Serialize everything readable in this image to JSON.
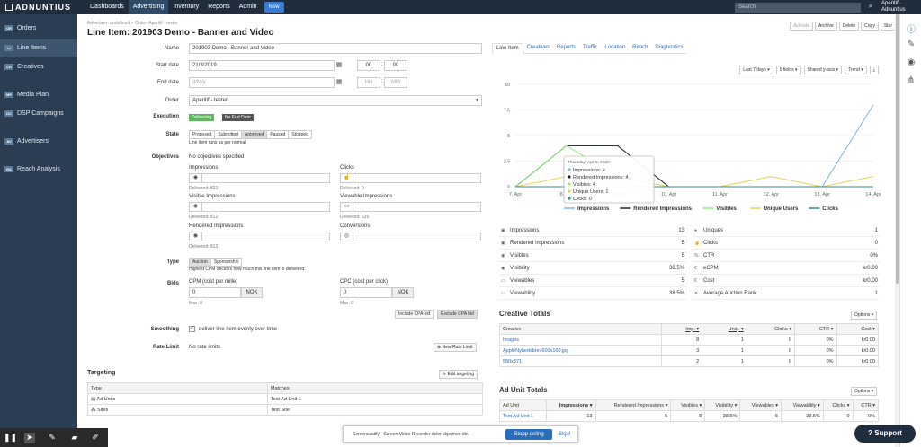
{
  "app": {
    "logo": "ADNUNTIUS",
    "nav": [
      "Dashboards",
      "Advertising",
      "Inventory",
      "Reports",
      "Admin"
    ],
    "new_label": "New",
    "search_placeholder": "Search",
    "user_line1": "Aperitif ·",
    "user_line2": "Adnuntius"
  },
  "sidebar": {
    "items": [
      {
        "icon": "OR",
        "label": "Orders"
      },
      {
        "icon": "LI",
        "label": "Line Items"
      },
      {
        "icon": "CR",
        "label": "Creatives"
      },
      {
        "icon": "MP",
        "label": "Media Plan"
      },
      {
        "icon": "DC",
        "label": "DSP Campaigns"
      },
      {
        "icon": "AV",
        "label": "Advertisers"
      },
      {
        "icon": "RA",
        "label": "Reach Analysis"
      }
    ]
  },
  "page": {
    "breadcrumb": "Advertiser: undefined  >  Order: Aperitif - tester",
    "title": "Line Item: 201903 Demo - Banner and Video",
    "top_buttons": [
      "Activate",
      "Archive",
      "Delete",
      "Copy",
      "Star"
    ]
  },
  "form": {
    "name_label": "Name",
    "name_value": "201903 Demo - Banner and Video",
    "start_label": "Start date",
    "start_value": "21/3/2019",
    "start_h": "00",
    "start_m": "00",
    "end_label": "End date",
    "end_placeholder": "d/M/y",
    "end_h": "HH",
    "end_m": "MM",
    "order_label": "Order",
    "order_value": "Aperitif - tester",
    "execution_label": "Execution",
    "exec_badge1": "Delivering",
    "exec_badge2": "No End Date",
    "state_label": "State",
    "states": [
      "Proposed",
      "Submitted",
      "Approved",
      "Paused",
      "Stopped"
    ],
    "state_note": "Line item runs as per normal",
    "objectives_label": "Objectives",
    "objectives_note": "No objectives specified",
    "obj": [
      {
        "title": "Impressions",
        "delivered": "Delivered: 823"
      },
      {
        "title": "Clicks",
        "delivered": "Delivered: 0"
      },
      {
        "title": "Visible Impressions",
        "delivered": "Delivered: 812"
      },
      {
        "title": "Viewable Impressions",
        "delivered": "Delivered: 639"
      },
      {
        "title": "Rendered Impressions",
        "delivered": "Delivered: 813"
      },
      {
        "title": "Conversions",
        "delivered": ""
      }
    ],
    "type_label": "Type",
    "types": [
      "Auction",
      "Sponsorship"
    ],
    "type_note": "Highest CPM decides how much this line item is delivered",
    "bids_label": "Bids",
    "cpm_label": "CPM (cost per mille)",
    "cpm_value": "0",
    "cpm_cur": "NOK",
    "cpm_max": "Max: 0",
    "cpc_label": "CPC (cost per click)",
    "cpc_value": "0",
    "cpc_cur": "NOK",
    "cpc_max": "Max: 0",
    "include_btn": "Include CPA bid",
    "exclude_btn": "Exclude CPA bid",
    "smoothing_label": "Smoothing",
    "smoothing_text": "deliver line item evenly over time",
    "rate_label": "Rate Limit",
    "rate_text": "No rate limits",
    "new_rate_btn": "New Rate Limit"
  },
  "targeting": {
    "title": "Targeting",
    "edit_btn": "Edit targeting",
    "headers": [
      "Type",
      "Matches"
    ],
    "rows": [
      [
        "Ad Units",
        "Test Ad Unit 1"
      ],
      [
        "Sites",
        "Test Site"
      ]
    ]
  },
  "tabs": [
    "Line Item",
    "Creatives",
    "Reports",
    "Traffic",
    "Location",
    "Reach",
    "Diagnostics"
  ],
  "chart_controls": [
    "Last 7 days",
    "5 fields",
    "Shared y-axis",
    "Trend"
  ],
  "chart_data": {
    "type": "line",
    "x": [
      "7. Apr",
      "8. Apr",
      "9. Apr",
      "10. Apr",
      "11. Apr",
      "12. Apr",
      "13. Apr",
      "14. Apr"
    ],
    "ylim": [
      0,
      10
    ],
    "yticks": [
      "0",
      "2.5",
      "5",
      "7.5",
      "10"
    ],
    "series": [
      {
        "name": "Impressions",
        "color": "#7cb5ec",
        "values": [
          0,
          4,
          4,
          0,
          0,
          0,
          0,
          8
        ]
      },
      {
        "name": "Rendered Impressions",
        "color": "#222222",
        "values": [
          0,
          4,
          4,
          0,
          0,
          0,
          0,
          0
        ]
      },
      {
        "name": "Visibles",
        "color": "#90ed7d",
        "values": [
          0,
          4,
          1,
          0,
          0,
          0,
          0,
          0
        ]
      },
      {
        "name": "Unique Users",
        "color": "#e4d354",
        "values": [
          0,
          1,
          1,
          0,
          0,
          1,
          0,
          1
        ]
      },
      {
        "name": "Clicks",
        "color": "#2b908f",
        "values": [
          0,
          0,
          0,
          0,
          0,
          0,
          0,
          0
        ]
      }
    ],
    "tooltip": {
      "title": "Thursday, Apr 9, 2020",
      "lines": [
        "Impressions: 4",
        "Rendered Impressions: 4",
        "Visibles: 4",
        "Unique Users: 1",
        "Clicks: 0"
      ]
    }
  },
  "stats_left": [
    {
      "icon": "▣",
      "label": "Impressions",
      "value": "13"
    },
    {
      "icon": "▣",
      "label": "Rendered Impressions",
      "value": "5"
    },
    {
      "icon": "◉",
      "label": "Visibles",
      "value": "5"
    },
    {
      "icon": "◉",
      "label": "Visibility",
      "value": "38.5%"
    },
    {
      "icon": "▭",
      "label": "Viewables",
      "value": "5"
    },
    {
      "icon": "▭",
      "label": "Viewability",
      "value": "38.5%"
    }
  ],
  "stats_right": [
    {
      "icon": "●",
      "label": "Uniques",
      "value": "1"
    },
    {
      "icon": "☝",
      "label": "Clicks",
      "value": "0"
    },
    {
      "icon": "%",
      "label": "CTR",
      "value": "0%"
    },
    {
      "icon": "€",
      "label": "eCPM",
      "value": "kr0.00"
    },
    {
      "icon": "€",
      "label": "Cost",
      "value": "kr0.00"
    },
    {
      "icon": "✕",
      "label": "Average Auction Rank",
      "value": "1"
    }
  ],
  "creative_totals": {
    "title": "Creative Totals",
    "options": "Options",
    "headers": [
      "Creative",
      "Imp.",
      "Uniq.",
      "Clicks",
      "CTR",
      "Cost"
    ],
    "rows": [
      [
        "Images",
        "8",
        "1",
        "0",
        "0%",
        "kr0.00"
      ],
      [
        "AppleNyhedsbrev600x160.jpg",
        "3",
        "1",
        "0",
        "0%",
        "kr0.00"
      ],
      [
        "580x371",
        "2",
        "1",
        "0",
        "0%",
        "kr0.00"
      ]
    ]
  },
  "ad_unit_totals": {
    "title": "Ad Unit Totals",
    "options": "Options",
    "headers": [
      "Ad Unit",
      "Impressions",
      "Rendered Impressions",
      "Visibles",
      "Visibility",
      "Viewables",
      "Viewability",
      "Clicks",
      "CTR"
    ],
    "rows": [
      [
        "Test Ad Unit 1",
        "13",
        "5",
        "5",
        "38.5%",
        "5",
        "38.5%",
        "0",
        "0%"
      ]
    ]
  },
  "recorder": {
    "notice": "Screencastify - Screen Video Recorder deler skjermen din.",
    "stop": "Stopp deling",
    "hide": "Skjul"
  },
  "support": "Support"
}
